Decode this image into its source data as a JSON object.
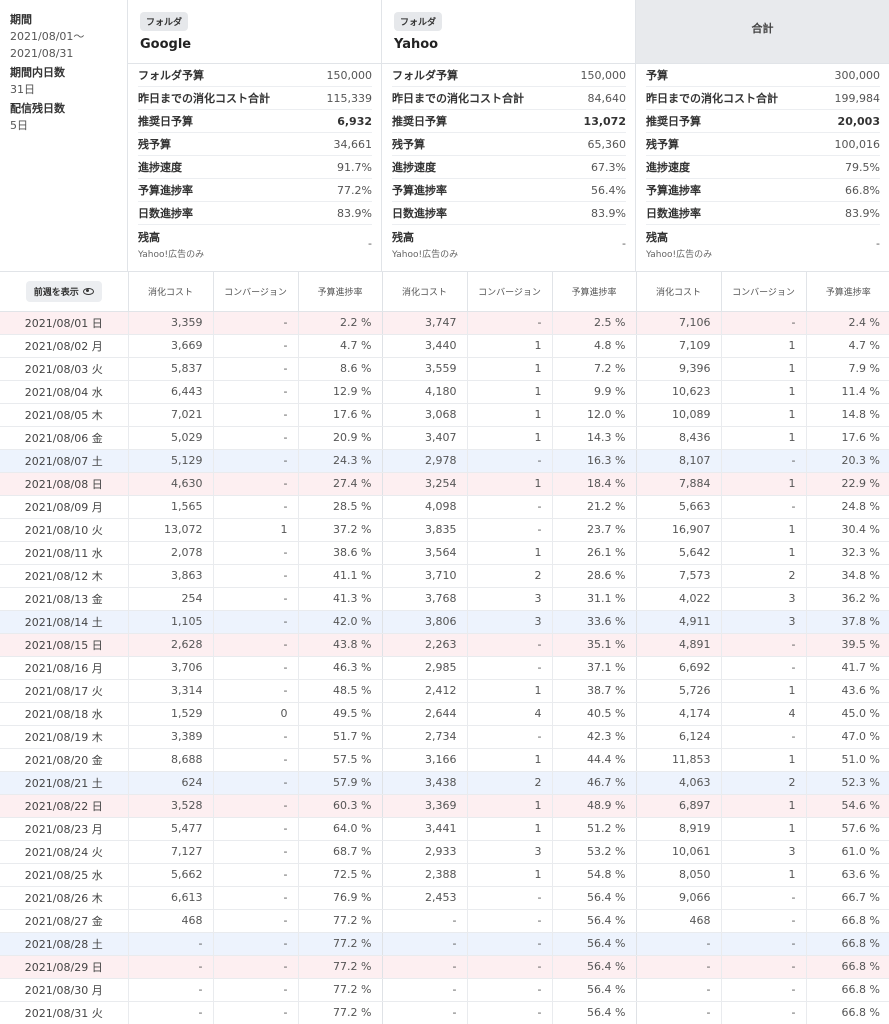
{
  "period": {
    "label": "期間",
    "start": "2021/08/01〜",
    "end": "2021/08/31",
    "days_label": "期間内日数",
    "days": "31日",
    "remaining_label": "配信残日数",
    "remaining": "5日"
  },
  "folders": [
    {
      "badge": "フォルダ",
      "name": "Google",
      "stats": [
        {
          "k": "フォルダ予算",
          "v": "150,000"
        },
        {
          "k": "昨日までの消化コスト合計",
          "v": "115,339"
        },
        {
          "k": "推奨日予算",
          "v": "6,932",
          "bold": true
        },
        {
          "k": "残予算",
          "v": "34,661"
        },
        {
          "k": "進捗速度",
          "v": "91.7%"
        },
        {
          "k": "予算進捗率",
          "v": "77.2%"
        },
        {
          "k": "日数進捗率",
          "v": "83.9%"
        }
      ],
      "balance": {
        "k": "残高",
        "sub": "Yahoo!広告のみ",
        "v": "-"
      }
    },
    {
      "badge": "フォルダ",
      "name": "Yahoo",
      "stats": [
        {
          "k": "フォルダ予算",
          "v": "150,000"
        },
        {
          "k": "昨日までの消化コスト合計",
          "v": "84,640"
        },
        {
          "k": "推奨日予算",
          "v": "13,072",
          "bold": true
        },
        {
          "k": "残予算",
          "v": "65,360"
        },
        {
          "k": "進捗速度",
          "v": "67.3%"
        },
        {
          "k": "予算進捗率",
          "v": "56.4%"
        },
        {
          "k": "日数進捗率",
          "v": "83.9%"
        }
      ],
      "balance": {
        "k": "残高",
        "sub": "Yahoo!広告のみ",
        "v": "-"
      }
    },
    {
      "title": "合計",
      "stats": [
        {
          "k": "予算",
          "v": "300,000"
        },
        {
          "k": "昨日までの消化コスト合計",
          "v": "199,984"
        },
        {
          "k": "推奨日予算",
          "v": "20,003",
          "bold": true
        },
        {
          "k": "残予算",
          "v": "100,016"
        },
        {
          "k": "進捗速度",
          "v": "79.5%"
        },
        {
          "k": "予算進捗率",
          "v": "66.8%"
        },
        {
          "k": "日数進捗率",
          "v": "83.9%"
        }
      ],
      "balance": {
        "k": "残高",
        "sub": "Yahoo!広告のみ",
        "v": "-"
      }
    }
  ],
  "table": {
    "prev_week_button": "前週を表示",
    "col_labels": [
      "消化コスト",
      "コンバージョン",
      "予算進捗率"
    ],
    "rows": [
      {
        "date": "2021/08/01 日",
        "day": "sun",
        "g": [
          "3,359",
          "-",
          "2.2 %"
        ],
        "y": [
          "3,747",
          "-",
          "2.5 %"
        ],
        "t": [
          "7,106",
          "-",
          "2.4 %"
        ]
      },
      {
        "date": "2021/08/02 月",
        "day": "",
        "g": [
          "3,669",
          "-",
          "4.7 %"
        ],
        "y": [
          "3,440",
          "1",
          "4.8 %"
        ],
        "t": [
          "7,109",
          "1",
          "4.7 %"
        ]
      },
      {
        "date": "2021/08/03 火",
        "day": "",
        "g": [
          "5,837",
          "-",
          "8.6 %"
        ],
        "y": [
          "3,559",
          "1",
          "7.2 %"
        ],
        "t": [
          "9,396",
          "1",
          "7.9 %"
        ]
      },
      {
        "date": "2021/08/04 水",
        "day": "",
        "g": [
          "6,443",
          "-",
          "12.9 %"
        ],
        "y": [
          "4,180",
          "1",
          "9.9 %"
        ],
        "t": [
          "10,623",
          "1",
          "11.4 %"
        ]
      },
      {
        "date": "2021/08/05 木",
        "day": "",
        "g": [
          "7,021",
          "-",
          "17.6 %"
        ],
        "y": [
          "3,068",
          "1",
          "12.0 %"
        ],
        "t": [
          "10,089",
          "1",
          "14.8 %"
        ]
      },
      {
        "date": "2021/08/06 金",
        "day": "",
        "g": [
          "5,029",
          "-",
          "20.9 %"
        ],
        "y": [
          "3,407",
          "1",
          "14.3 %"
        ],
        "t": [
          "8,436",
          "1",
          "17.6 %"
        ]
      },
      {
        "date": "2021/08/07 土",
        "day": "sat",
        "g": [
          "5,129",
          "-",
          "24.3 %"
        ],
        "y": [
          "2,978",
          "-",
          "16.3 %"
        ],
        "t": [
          "8,107",
          "-",
          "20.3 %"
        ]
      },
      {
        "date": "2021/08/08 日",
        "day": "sun",
        "g": [
          "4,630",
          "-",
          "27.4 %"
        ],
        "y": [
          "3,254",
          "1",
          "18.4 %"
        ],
        "t": [
          "7,884",
          "1",
          "22.9 %"
        ]
      },
      {
        "date": "2021/08/09 月",
        "day": "",
        "g": [
          "1,565",
          "-",
          "28.5 %"
        ],
        "y": [
          "4,098",
          "-",
          "21.2 %"
        ],
        "t": [
          "5,663",
          "-",
          "24.8 %"
        ]
      },
      {
        "date": "2021/08/10 火",
        "day": "",
        "g": [
          "13,072",
          "1",
          "37.2 %"
        ],
        "y": [
          "3,835",
          "-",
          "23.7 %"
        ],
        "t": [
          "16,907",
          "1",
          "30.4 %"
        ]
      },
      {
        "date": "2021/08/11 水",
        "day": "",
        "g": [
          "2,078",
          "-",
          "38.6 %"
        ],
        "y": [
          "3,564",
          "1",
          "26.1 %"
        ],
        "t": [
          "5,642",
          "1",
          "32.3 %"
        ]
      },
      {
        "date": "2021/08/12 木",
        "day": "",
        "g": [
          "3,863",
          "-",
          "41.1 %"
        ],
        "y": [
          "3,710",
          "2",
          "28.6 %"
        ],
        "t": [
          "7,573",
          "2",
          "34.8 %"
        ]
      },
      {
        "date": "2021/08/13 金",
        "day": "",
        "g": [
          "254",
          "-",
          "41.3 %"
        ],
        "y": [
          "3,768",
          "3",
          "31.1 %"
        ],
        "t": [
          "4,022",
          "3",
          "36.2 %"
        ]
      },
      {
        "date": "2021/08/14 土",
        "day": "sat",
        "g": [
          "1,105",
          "-",
          "42.0 %"
        ],
        "y": [
          "3,806",
          "3",
          "33.6 %"
        ],
        "t": [
          "4,911",
          "3",
          "37.8 %"
        ]
      },
      {
        "date": "2021/08/15 日",
        "day": "sun",
        "g": [
          "2,628",
          "-",
          "43.8 %"
        ],
        "y": [
          "2,263",
          "-",
          "35.1 %"
        ],
        "t": [
          "4,891",
          "-",
          "39.5 %"
        ]
      },
      {
        "date": "2021/08/16 月",
        "day": "",
        "g": [
          "3,706",
          "-",
          "46.3 %"
        ],
        "y": [
          "2,985",
          "-",
          "37.1 %"
        ],
        "t": [
          "6,692",
          "-",
          "41.7 %"
        ]
      },
      {
        "date": "2021/08/17 火",
        "day": "",
        "g": [
          "3,314",
          "-",
          "48.5 %"
        ],
        "y": [
          "2,412",
          "1",
          "38.7 %"
        ],
        "t": [
          "5,726",
          "1",
          "43.6 %"
        ]
      },
      {
        "date": "2021/08/18 水",
        "day": "",
        "g": [
          "1,529",
          "0",
          "49.5 %"
        ],
        "y": [
          "2,644",
          "4",
          "40.5 %"
        ],
        "t": [
          "4,174",
          "4",
          "45.0 %"
        ]
      },
      {
        "date": "2021/08/19 木",
        "day": "",
        "g": [
          "3,389",
          "-",
          "51.7 %"
        ],
        "y": [
          "2,734",
          "-",
          "42.3 %"
        ],
        "t": [
          "6,124",
          "-",
          "47.0 %"
        ]
      },
      {
        "date": "2021/08/20 金",
        "day": "",
        "g": [
          "8,688",
          "-",
          "57.5 %"
        ],
        "y": [
          "3,166",
          "1",
          "44.4 %"
        ],
        "t": [
          "11,853",
          "1",
          "51.0 %"
        ]
      },
      {
        "date": "2021/08/21 土",
        "day": "sat",
        "g": [
          "624",
          "-",
          "57.9 %"
        ],
        "y": [
          "3,438",
          "2",
          "46.7 %"
        ],
        "t": [
          "4,063",
          "2",
          "52.3 %"
        ]
      },
      {
        "date": "2021/08/22 日",
        "day": "sun",
        "g": [
          "3,528",
          "-",
          "60.3 %"
        ],
        "y": [
          "3,369",
          "1",
          "48.9 %"
        ],
        "t": [
          "6,897",
          "1",
          "54.6 %"
        ]
      },
      {
        "date": "2021/08/23 月",
        "day": "",
        "g": [
          "5,477",
          "-",
          "64.0 %"
        ],
        "y": [
          "3,441",
          "1",
          "51.2 %"
        ],
        "t": [
          "8,919",
          "1",
          "57.6 %"
        ]
      },
      {
        "date": "2021/08/24 火",
        "day": "",
        "g": [
          "7,127",
          "-",
          "68.7 %"
        ],
        "y": [
          "2,933",
          "3",
          "53.2 %"
        ],
        "t": [
          "10,061",
          "3",
          "61.0 %"
        ]
      },
      {
        "date": "2021/08/25 水",
        "day": "",
        "g": [
          "5,662",
          "-",
          "72.5 %"
        ],
        "y": [
          "2,388",
          "1",
          "54.8 %"
        ],
        "t": [
          "8,050",
          "1",
          "63.6 %"
        ]
      },
      {
        "date": "2021/08/26 木",
        "day": "",
        "g": [
          "6,613",
          "-",
          "76.9 %"
        ],
        "y": [
          "2,453",
          "-",
          "56.4 %"
        ],
        "t": [
          "9,066",
          "-",
          "66.7 %"
        ]
      },
      {
        "date": "2021/08/27 金",
        "day": "",
        "g": [
          "468",
          "-",
          "77.2 %"
        ],
        "y": [
          "-",
          "-",
          "56.4 %"
        ],
        "t": [
          "468",
          "-",
          "66.8 %"
        ]
      },
      {
        "date": "2021/08/28 土",
        "day": "sat",
        "g": [
          "-",
          "-",
          "77.2 %"
        ],
        "y": [
          "-",
          "-",
          "56.4 %"
        ],
        "t": [
          "-",
          "-",
          "66.8 %"
        ]
      },
      {
        "date": "2021/08/29 日",
        "day": "sun",
        "g": [
          "-",
          "-",
          "77.2 %"
        ],
        "y": [
          "-",
          "-",
          "56.4 %"
        ],
        "t": [
          "-",
          "-",
          "66.8 %"
        ]
      },
      {
        "date": "2021/08/30 月",
        "day": "",
        "g": [
          "-",
          "-",
          "77.2 %"
        ],
        "y": [
          "-",
          "-",
          "56.4 %"
        ],
        "t": [
          "-",
          "-",
          "66.8 %"
        ]
      },
      {
        "date": "2021/08/31 火",
        "day": "",
        "g": [
          "-",
          "-",
          "77.2 %"
        ],
        "y": [
          "-",
          "-",
          "56.4 %"
        ],
        "t": [
          "-",
          "-",
          "66.8 %"
        ]
      }
    ]
  }
}
